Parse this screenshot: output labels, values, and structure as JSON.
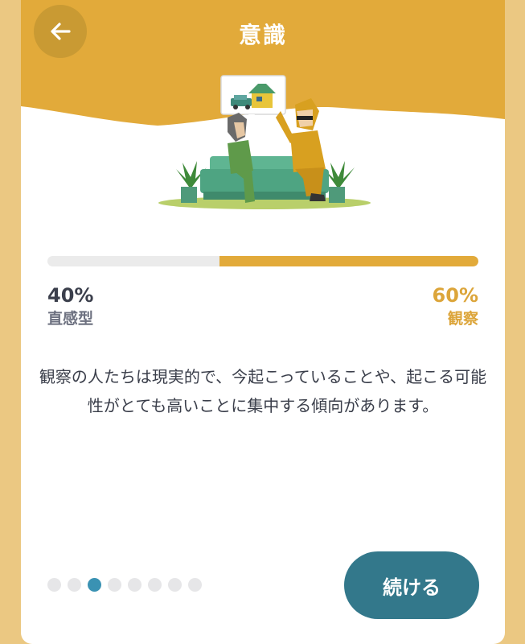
{
  "header": {
    "title": "意識",
    "back_icon": "arrow-left-icon",
    "background_color": "#e2aa3a"
  },
  "result": {
    "left": {
      "percent_label": "40%",
      "label": "直感型",
      "value": 0.4
    },
    "right": {
      "percent_label": "60%",
      "label": "観察",
      "value": 0.6,
      "color": "#dca53a"
    }
  },
  "description": "観察の人たちは現実的で、今起こっていることや、起こる可能性がとても高いことに集中する傾向があります。",
  "pagination": {
    "total": 8,
    "active_index": 2,
    "active_color": "#3a92b3"
  },
  "continue_button": {
    "label": "続ける",
    "color": "#33788b"
  }
}
